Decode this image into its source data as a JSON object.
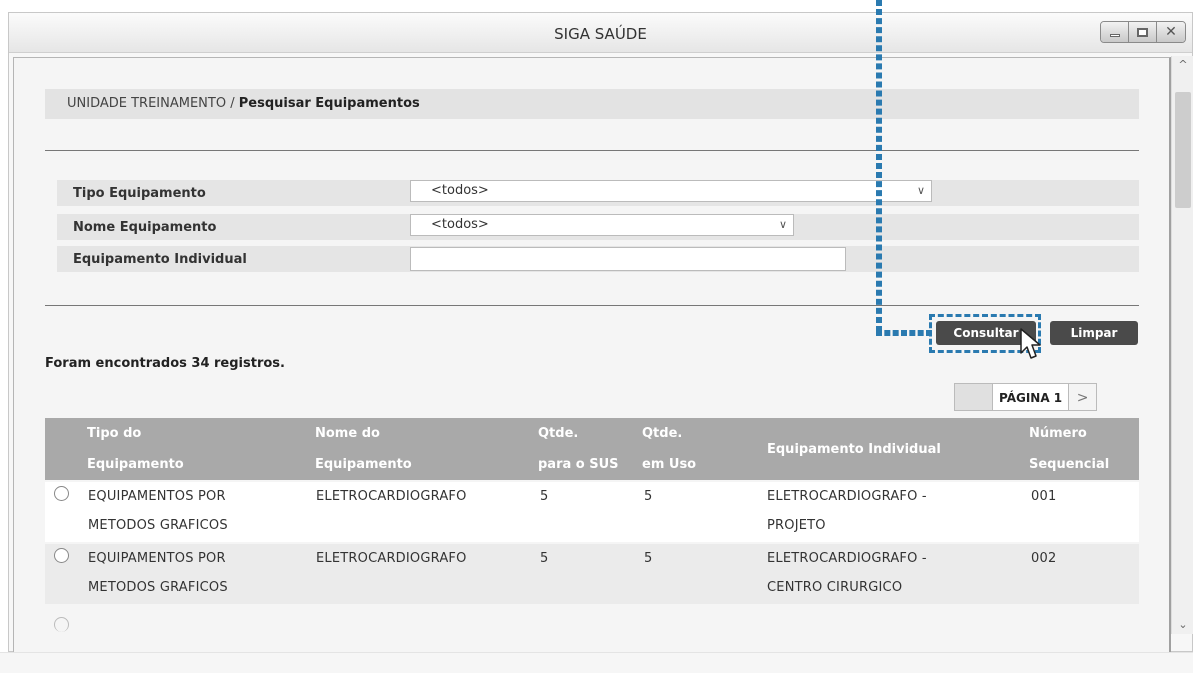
{
  "window": {
    "title": "SIGA SAÚDE"
  },
  "breadcrumb": {
    "unit": "UNIDADE TREINAMENTO /",
    "current": "Pesquisar Equipamentos"
  },
  "filters": {
    "tipo_label": "Tipo Equipamento",
    "tipo_value": "<todos>",
    "nome_label": "Nome Equipamento",
    "nome_value": "<todos>",
    "individual_label": "Equipamento Individual",
    "individual_value": ""
  },
  "buttons": {
    "consultar": "Consultar",
    "limpar": "Limpar"
  },
  "result_count": "Foram encontrados 34 registros.",
  "pager": {
    "label": "PÁGINA 1"
  },
  "table": {
    "headers": {
      "tipo_1": "Tipo do",
      "tipo_2": "Equipamento",
      "nome_1": "Nome do",
      "nome_2": "Equipamento",
      "sus_1": "Qtde.",
      "sus_2": "para o SUS",
      "uso_1": "Qtde.",
      "uso_2": "em Uso",
      "individual": "Equipamento Individual",
      "seq_1": "Número",
      "seq_2": "Sequencial"
    },
    "rows": [
      {
        "tipo_1": "EQUIPAMENTOS POR",
        "tipo_2": "METODOS GRAFICOS",
        "nome": "ELETROCARDIOGRAFO",
        "sus": "5",
        "uso": "5",
        "ind_1": "ELETROCARDIOGRAFO -",
        "ind_2": "PROJETO",
        "seq": "001"
      },
      {
        "tipo_1": "EQUIPAMENTOS POR",
        "tipo_2": "METODOS GRAFICOS",
        "nome": "ELETROCARDIOGRAFO",
        "sus": "5",
        "uso": "5",
        "ind_1": "ELETROCARDIOGRAFO -",
        "ind_2": "CENTRO CIRURGICO",
        "seq": "002"
      }
    ]
  },
  "colors": {
    "highlight": "#2a7ab0",
    "button": "#4a4a4a",
    "table_header": "#a9a9a9"
  }
}
